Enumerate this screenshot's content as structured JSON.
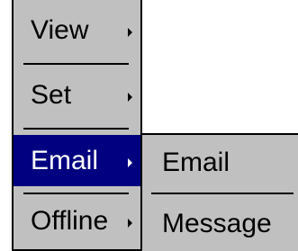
{
  "menu": {
    "items": [
      {
        "label": "View",
        "has_submenu": true
      },
      {
        "label": "Set",
        "has_submenu": true
      },
      {
        "label": "Email",
        "has_submenu": true,
        "selected": true
      },
      {
        "label": "Offline",
        "has_submenu": true
      }
    ]
  },
  "submenu": {
    "items": [
      {
        "label": "Email"
      },
      {
        "label": "Message"
      }
    ]
  },
  "colors": {
    "menu_bg": "#c0c0c0",
    "highlight_bg": "#000080",
    "highlight_text": "#ffffff",
    "text": "#000000"
  }
}
